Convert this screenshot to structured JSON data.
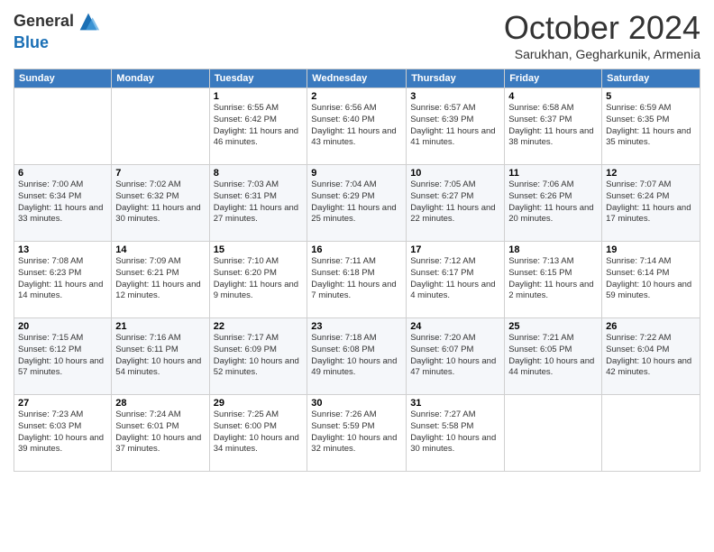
{
  "header": {
    "logo_line1": "General",
    "logo_line2": "Blue",
    "month": "October 2024",
    "location": "Sarukhan, Gegharkunik, Armenia"
  },
  "weekdays": [
    "Sunday",
    "Monday",
    "Tuesday",
    "Wednesday",
    "Thursday",
    "Friday",
    "Saturday"
  ],
  "weeks": [
    [
      {
        "day": "",
        "sunrise": "",
        "sunset": "",
        "daylight": ""
      },
      {
        "day": "",
        "sunrise": "",
        "sunset": "",
        "daylight": ""
      },
      {
        "day": "1",
        "sunrise": "Sunrise: 6:55 AM",
        "sunset": "Sunset: 6:42 PM",
        "daylight": "Daylight: 11 hours and 46 minutes."
      },
      {
        "day": "2",
        "sunrise": "Sunrise: 6:56 AM",
        "sunset": "Sunset: 6:40 PM",
        "daylight": "Daylight: 11 hours and 43 minutes."
      },
      {
        "day": "3",
        "sunrise": "Sunrise: 6:57 AM",
        "sunset": "Sunset: 6:39 PM",
        "daylight": "Daylight: 11 hours and 41 minutes."
      },
      {
        "day": "4",
        "sunrise": "Sunrise: 6:58 AM",
        "sunset": "Sunset: 6:37 PM",
        "daylight": "Daylight: 11 hours and 38 minutes."
      },
      {
        "day": "5",
        "sunrise": "Sunrise: 6:59 AM",
        "sunset": "Sunset: 6:35 PM",
        "daylight": "Daylight: 11 hours and 35 minutes."
      }
    ],
    [
      {
        "day": "6",
        "sunrise": "Sunrise: 7:00 AM",
        "sunset": "Sunset: 6:34 PM",
        "daylight": "Daylight: 11 hours and 33 minutes."
      },
      {
        "day": "7",
        "sunrise": "Sunrise: 7:02 AM",
        "sunset": "Sunset: 6:32 PM",
        "daylight": "Daylight: 11 hours and 30 minutes."
      },
      {
        "day": "8",
        "sunrise": "Sunrise: 7:03 AM",
        "sunset": "Sunset: 6:31 PM",
        "daylight": "Daylight: 11 hours and 27 minutes."
      },
      {
        "day": "9",
        "sunrise": "Sunrise: 7:04 AM",
        "sunset": "Sunset: 6:29 PM",
        "daylight": "Daylight: 11 hours and 25 minutes."
      },
      {
        "day": "10",
        "sunrise": "Sunrise: 7:05 AM",
        "sunset": "Sunset: 6:27 PM",
        "daylight": "Daylight: 11 hours and 22 minutes."
      },
      {
        "day": "11",
        "sunrise": "Sunrise: 7:06 AM",
        "sunset": "Sunset: 6:26 PM",
        "daylight": "Daylight: 11 hours and 20 minutes."
      },
      {
        "day": "12",
        "sunrise": "Sunrise: 7:07 AM",
        "sunset": "Sunset: 6:24 PM",
        "daylight": "Daylight: 11 hours and 17 minutes."
      }
    ],
    [
      {
        "day": "13",
        "sunrise": "Sunrise: 7:08 AM",
        "sunset": "Sunset: 6:23 PM",
        "daylight": "Daylight: 11 hours and 14 minutes."
      },
      {
        "day": "14",
        "sunrise": "Sunrise: 7:09 AM",
        "sunset": "Sunset: 6:21 PM",
        "daylight": "Daylight: 11 hours and 12 minutes."
      },
      {
        "day": "15",
        "sunrise": "Sunrise: 7:10 AM",
        "sunset": "Sunset: 6:20 PM",
        "daylight": "Daylight: 11 hours and 9 minutes."
      },
      {
        "day": "16",
        "sunrise": "Sunrise: 7:11 AM",
        "sunset": "Sunset: 6:18 PM",
        "daylight": "Daylight: 11 hours and 7 minutes."
      },
      {
        "day": "17",
        "sunrise": "Sunrise: 7:12 AM",
        "sunset": "Sunset: 6:17 PM",
        "daylight": "Daylight: 11 hours and 4 minutes."
      },
      {
        "day": "18",
        "sunrise": "Sunrise: 7:13 AM",
        "sunset": "Sunset: 6:15 PM",
        "daylight": "Daylight: 11 hours and 2 minutes."
      },
      {
        "day": "19",
        "sunrise": "Sunrise: 7:14 AM",
        "sunset": "Sunset: 6:14 PM",
        "daylight": "Daylight: 10 hours and 59 minutes."
      }
    ],
    [
      {
        "day": "20",
        "sunrise": "Sunrise: 7:15 AM",
        "sunset": "Sunset: 6:12 PM",
        "daylight": "Daylight: 10 hours and 57 minutes."
      },
      {
        "day": "21",
        "sunrise": "Sunrise: 7:16 AM",
        "sunset": "Sunset: 6:11 PM",
        "daylight": "Daylight: 10 hours and 54 minutes."
      },
      {
        "day": "22",
        "sunrise": "Sunrise: 7:17 AM",
        "sunset": "Sunset: 6:09 PM",
        "daylight": "Daylight: 10 hours and 52 minutes."
      },
      {
        "day": "23",
        "sunrise": "Sunrise: 7:18 AM",
        "sunset": "Sunset: 6:08 PM",
        "daylight": "Daylight: 10 hours and 49 minutes."
      },
      {
        "day": "24",
        "sunrise": "Sunrise: 7:20 AM",
        "sunset": "Sunset: 6:07 PM",
        "daylight": "Daylight: 10 hours and 47 minutes."
      },
      {
        "day": "25",
        "sunrise": "Sunrise: 7:21 AM",
        "sunset": "Sunset: 6:05 PM",
        "daylight": "Daylight: 10 hours and 44 minutes."
      },
      {
        "day": "26",
        "sunrise": "Sunrise: 7:22 AM",
        "sunset": "Sunset: 6:04 PM",
        "daylight": "Daylight: 10 hours and 42 minutes."
      }
    ],
    [
      {
        "day": "27",
        "sunrise": "Sunrise: 7:23 AM",
        "sunset": "Sunset: 6:03 PM",
        "daylight": "Daylight: 10 hours and 39 minutes."
      },
      {
        "day": "28",
        "sunrise": "Sunrise: 7:24 AM",
        "sunset": "Sunset: 6:01 PM",
        "daylight": "Daylight: 10 hours and 37 minutes."
      },
      {
        "day": "29",
        "sunrise": "Sunrise: 7:25 AM",
        "sunset": "Sunset: 6:00 PM",
        "daylight": "Daylight: 10 hours and 34 minutes."
      },
      {
        "day": "30",
        "sunrise": "Sunrise: 7:26 AM",
        "sunset": "Sunset: 5:59 PM",
        "daylight": "Daylight: 10 hours and 32 minutes."
      },
      {
        "day": "31",
        "sunrise": "Sunrise: 7:27 AM",
        "sunset": "Sunset: 5:58 PM",
        "daylight": "Daylight: 10 hours and 30 minutes."
      },
      {
        "day": "",
        "sunrise": "",
        "sunset": "",
        "daylight": ""
      },
      {
        "day": "",
        "sunrise": "",
        "sunset": "",
        "daylight": ""
      }
    ]
  ]
}
